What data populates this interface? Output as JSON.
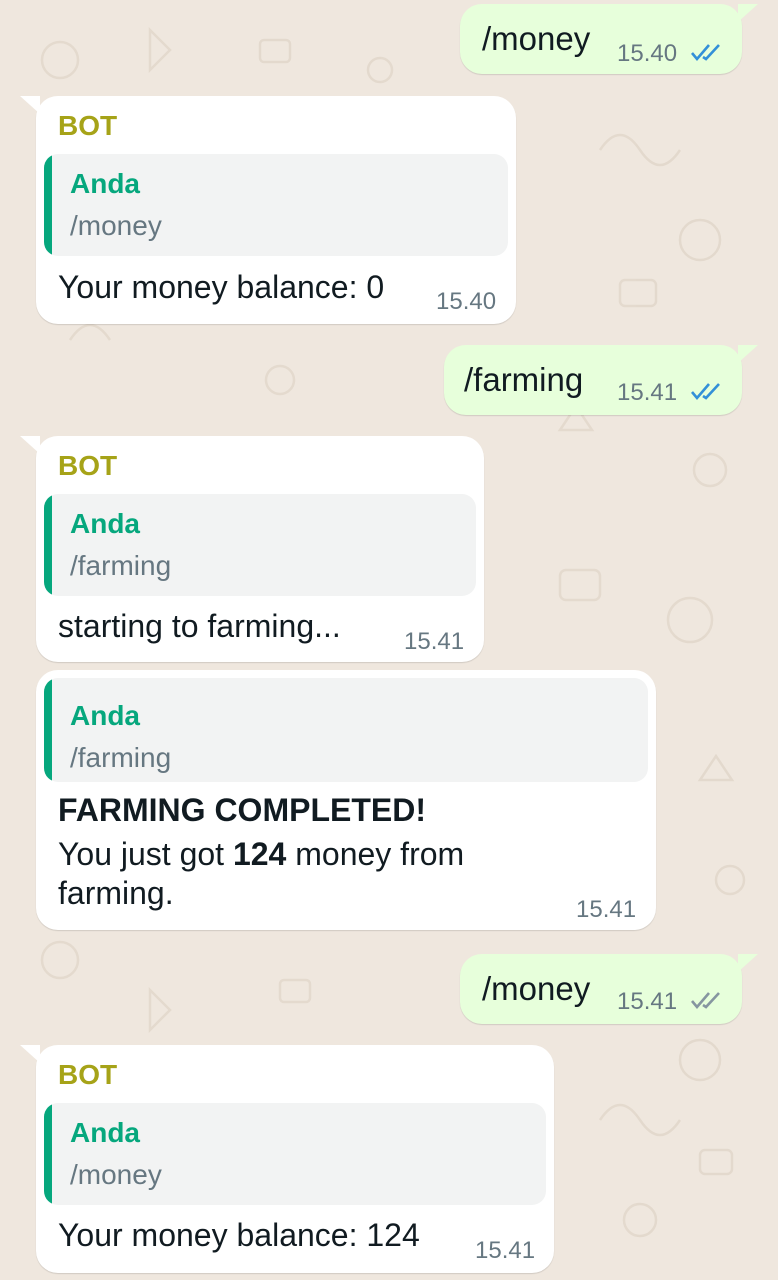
{
  "colors": {
    "outgoing_bubble": "#e7ffdb",
    "incoming_bubble": "#ffffff",
    "quote_background": "#f2f3f3",
    "sender_name": "#a6a318",
    "quote_author": "#06a77d",
    "quote_bar": "#06a77d",
    "read_ticks": "#3390d8",
    "delivered_ticks": "#8696a0",
    "chat_background": "#efe7de"
  },
  "messages": [
    {
      "text": "/money",
      "time": "15.40",
      "status": "read"
    },
    {
      "sender": "BOT",
      "quote_author": "Anda",
      "quote_text": "/money",
      "text": "Your money balance: 0",
      "time": "15.40"
    },
    {
      "text": "/farming",
      "time": "15.41",
      "status": "read"
    },
    {
      "sender": "BOT",
      "quote_author": "Anda",
      "quote_text": "/farming",
      "text": "starting to farming...",
      "time": "15.41"
    },
    {
      "quote_author": "Anda",
      "quote_text": "/farming",
      "title": "FARMING COMPLETED!",
      "line_prefix": "You just got ",
      "amount": "124",
      "line_suffix": " money from",
      "line2": "farming.",
      "time": "15.41"
    },
    {
      "text": "/money",
      "time": "15.41",
      "status": "delivered"
    },
    {
      "sender": "BOT",
      "quote_author": "Anda",
      "quote_text": "/money",
      "text": "Your money balance: 124",
      "time": "15.41"
    }
  ]
}
